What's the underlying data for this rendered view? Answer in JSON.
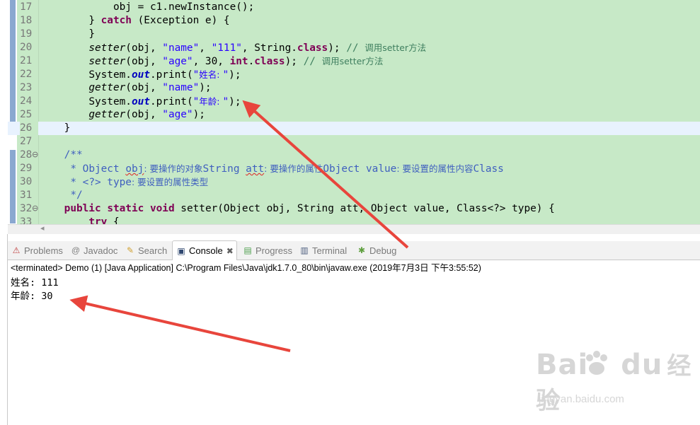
{
  "editor": {
    "lines": [
      {
        "n": "17",
        "t": [
          [
            "i",
            "            "
          ],
          [
            "p",
            "obj = c1.newInstance();"
          ]
        ]
      },
      {
        "n": "18",
        "t": [
          [
            "i",
            "        "
          ],
          [
            "p",
            "} "
          ],
          [
            "kw",
            "catch"
          ],
          [
            "p",
            " (Exception e) {"
          ]
        ]
      },
      {
        "n": "19",
        "t": [
          [
            "i",
            "        "
          ],
          [
            "p",
            "}"
          ]
        ]
      },
      {
        "n": "20",
        "t": [
          [
            "i",
            "        "
          ],
          [
            "it",
            "setter"
          ],
          [
            "p",
            "(obj, "
          ],
          [
            "str",
            "\"name\""
          ],
          [
            "p",
            ", "
          ],
          [
            "str",
            "\"111\""
          ],
          [
            "p",
            ", String."
          ],
          [
            "kw",
            "class"
          ],
          [
            "p",
            "); "
          ],
          [
            "cmt",
            "// "
          ],
          [
            "cmtc",
            "调用setter方法"
          ]
        ]
      },
      {
        "n": "21",
        "t": [
          [
            "i",
            "        "
          ],
          [
            "it",
            "setter"
          ],
          [
            "p",
            "(obj, "
          ],
          [
            "str",
            "\"age\""
          ],
          [
            "p",
            ", 30, "
          ],
          [
            "kw",
            "int"
          ],
          [
            "p",
            "."
          ],
          [
            "kw",
            "class"
          ],
          [
            "p",
            "); "
          ],
          [
            "cmt",
            "// "
          ],
          [
            "cmtc",
            "调用setter方法"
          ]
        ]
      },
      {
        "n": "22",
        "t": [
          [
            "i",
            "        "
          ],
          [
            "p",
            "System."
          ],
          [
            "fld",
            "out"
          ],
          [
            "p",
            ".print("
          ],
          [
            "str",
            "\""
          ],
          [
            "strc",
            "姓名: "
          ],
          [
            "str",
            "\""
          ],
          [
            "p",
            ");"
          ]
        ]
      },
      {
        "n": "23",
        "t": [
          [
            "i",
            "        "
          ],
          [
            "it",
            "getter"
          ],
          [
            "p",
            "(obj, "
          ],
          [
            "str",
            "\"name\""
          ],
          [
            "p",
            ");"
          ]
        ]
      },
      {
        "n": "24",
        "t": [
          [
            "i",
            "        "
          ],
          [
            "p",
            "System."
          ],
          [
            "fld",
            "out"
          ],
          [
            "p",
            ".print("
          ],
          [
            "str",
            "\""
          ],
          [
            "strc",
            "年龄: "
          ],
          [
            "str",
            "\""
          ],
          [
            "p",
            ");"
          ]
        ]
      },
      {
        "n": "25",
        "t": [
          [
            "i",
            "        "
          ],
          [
            "it",
            "getter"
          ],
          [
            "p",
            "(obj, "
          ],
          [
            "str",
            "\"age\""
          ],
          [
            "p",
            ");"
          ]
        ]
      },
      {
        "n": "26",
        "t": [
          [
            "i",
            "    "
          ],
          [
            "p",
            "}"
          ]
        ],
        "current": true
      },
      {
        "n": "27",
        "t": []
      },
      {
        "n": "28",
        "t": [
          [
            "i",
            "    "
          ],
          [
            "jd",
            "/**"
          ]
        ],
        "fold": true
      },
      {
        "n": "29",
        "t": [
          [
            "i",
            "     "
          ],
          [
            "jd",
            "* Object "
          ],
          [
            "jdsq",
            "obj"
          ],
          [
            "jdc",
            ": 要操作的对象"
          ],
          [
            "jd",
            "String "
          ],
          [
            "jdsq",
            "att"
          ],
          [
            "jdc",
            ": 要操作的属性"
          ],
          [
            "jd",
            "Object value"
          ],
          [
            "jdc",
            ": 要设置的属性内容"
          ],
          [
            "jd",
            "Class"
          ]
        ]
      },
      {
        "n": "30",
        "t": [
          [
            "i",
            "     "
          ],
          [
            "jd",
            "* <?> type"
          ],
          [
            "jdc",
            ": 要设置的属性类型"
          ]
        ]
      },
      {
        "n": "31",
        "t": [
          [
            "i",
            "     "
          ],
          [
            "jd",
            "*/"
          ]
        ]
      },
      {
        "n": "32",
        "t": [
          [
            "i",
            "    "
          ],
          [
            "kw",
            "public"
          ],
          [
            "p",
            " "
          ],
          [
            "kw",
            "static"
          ],
          [
            "p",
            " "
          ],
          [
            "kw",
            "void"
          ],
          [
            "p",
            " setter(Object obj, String att, Object value, Class<?> type) {"
          ]
        ],
        "fold": true
      },
      {
        "n": "33",
        "t": [
          [
            "i",
            "        "
          ],
          [
            "kw",
            "try"
          ],
          [
            "p",
            " {"
          ]
        ]
      }
    ]
  },
  "views": {
    "tabs": [
      {
        "id": "problems",
        "label": "Problems",
        "icon": "problems-icon",
        "glyph": "⚠",
        "color": "#c04040",
        "active": false
      },
      {
        "id": "javadoc",
        "label": "Javadoc",
        "icon": "javadoc-icon",
        "glyph": "@",
        "color": "#808080",
        "active": false
      },
      {
        "id": "search",
        "label": "Search",
        "icon": "search-icon",
        "glyph": "✎",
        "color": "#d0a030",
        "active": false
      },
      {
        "id": "console",
        "label": "Console",
        "icon": "console-icon",
        "glyph": "▣",
        "color": "#304870",
        "active": true
      },
      {
        "id": "progress",
        "label": "Progress",
        "icon": "progress-icon",
        "glyph": "▤",
        "color": "#50a050",
        "active": false
      },
      {
        "id": "terminal",
        "label": "Terminal",
        "icon": "terminal-icon",
        "glyph": "▥",
        "color": "#506080",
        "active": false
      },
      {
        "id": "debug",
        "label": "Debug",
        "icon": "debug-icon",
        "glyph": "✱",
        "color": "#60a040",
        "active": false
      }
    ],
    "close_glyph": "✖",
    "console": {
      "status": "<terminated> Demo (1) [Java Application] C:\\Program Files\\Java\\jdk1.7.0_80\\bin\\javaw.exe (2019年7月3日 下午3:55:52)",
      "output": [
        "姓名: 111",
        "年龄: 30"
      ]
    }
  },
  "scroll": {
    "left_arrow": "◂"
  },
  "watermark": {
    "logo": "Bai du 经验",
    "url": "jingyan.baidu.com"
  },
  "colors": {
    "editor_bg": "#c7e9c7",
    "current_line": "#e8f2fe",
    "keyword": "#7f0055",
    "string": "#2a00ff",
    "comment": "#3f7f5f",
    "javadoc": "#3f5fbf",
    "arrow": "#e8453c"
  }
}
